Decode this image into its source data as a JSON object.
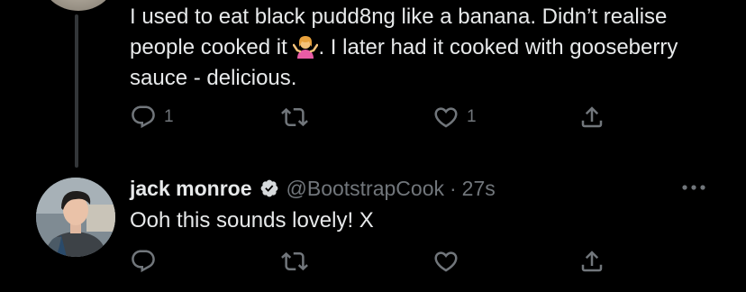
{
  "colors": {
    "background": "#000000",
    "text": "#e7e9ea",
    "muted": "#71767b",
    "verified": "#d6d9db",
    "thread_line": "#333639"
  },
  "tweet1": {
    "text_before_emoji": "I used to eat black pudd8ng like a banana. Didn’t realise people cooked it ",
    "emoji_icon": "person-shrugging-emoji",
    "text_after_emoji": ". I later had it cooked with gooseberry sauce - delicious.",
    "actions": {
      "reply_icon": "reply-icon",
      "reply_count": "1",
      "retweet_icon": "retweet-icon",
      "like_icon": "heart-icon",
      "like_count": "1",
      "share_icon": "share-icon"
    }
  },
  "tweet2": {
    "display_name": "jack monroe",
    "verified_icon": "verified-badge-icon",
    "handle": "@BootstrapCook",
    "separator": "·",
    "time": "27s",
    "more_icon": "more-horizontal-icon",
    "text": "Ooh this sounds lovely! X",
    "actions": {
      "reply_icon": "reply-icon",
      "retweet_icon": "retweet-icon",
      "like_icon": "heart-icon",
      "share_icon": "share-icon"
    }
  }
}
